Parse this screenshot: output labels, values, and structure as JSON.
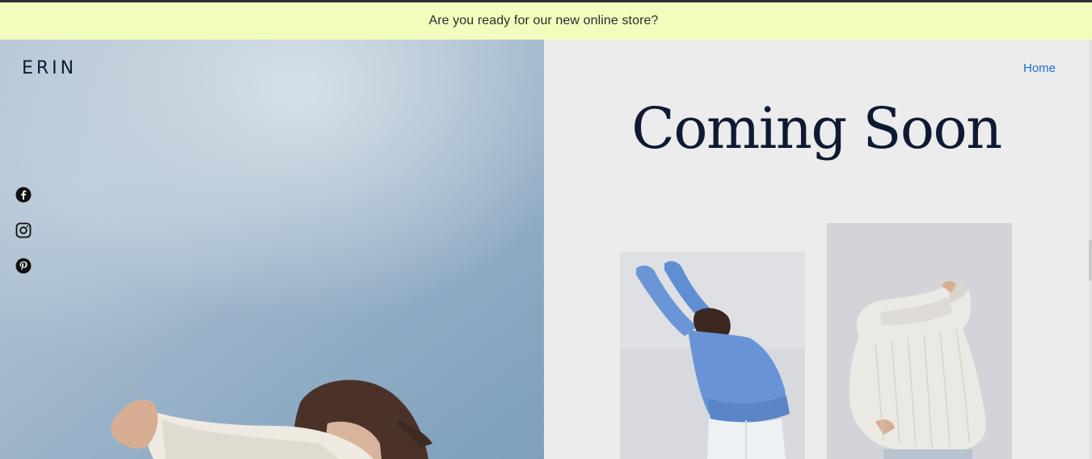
{
  "announcement": {
    "text": "Are you ready for our new online store?"
  },
  "brand": {
    "name": "ERIN"
  },
  "nav": {
    "items": [
      {
        "label": "Home"
      }
    ]
  },
  "hero": {
    "headline": "Coming Soon"
  },
  "social": [
    {
      "name": "facebook-icon",
      "label": "Facebook"
    },
    {
      "name": "instagram-icon",
      "label": "Instagram"
    },
    {
      "name": "pinterest-icon",
      "label": "Pinterest"
    }
  ],
  "colors": {
    "announcement_bg": "#f2fcbc",
    "right_panel_bg": "#ececec",
    "brand_text": "#0e1a33",
    "link": "#1f6fd6",
    "sky": "#8fa9c2"
  }
}
